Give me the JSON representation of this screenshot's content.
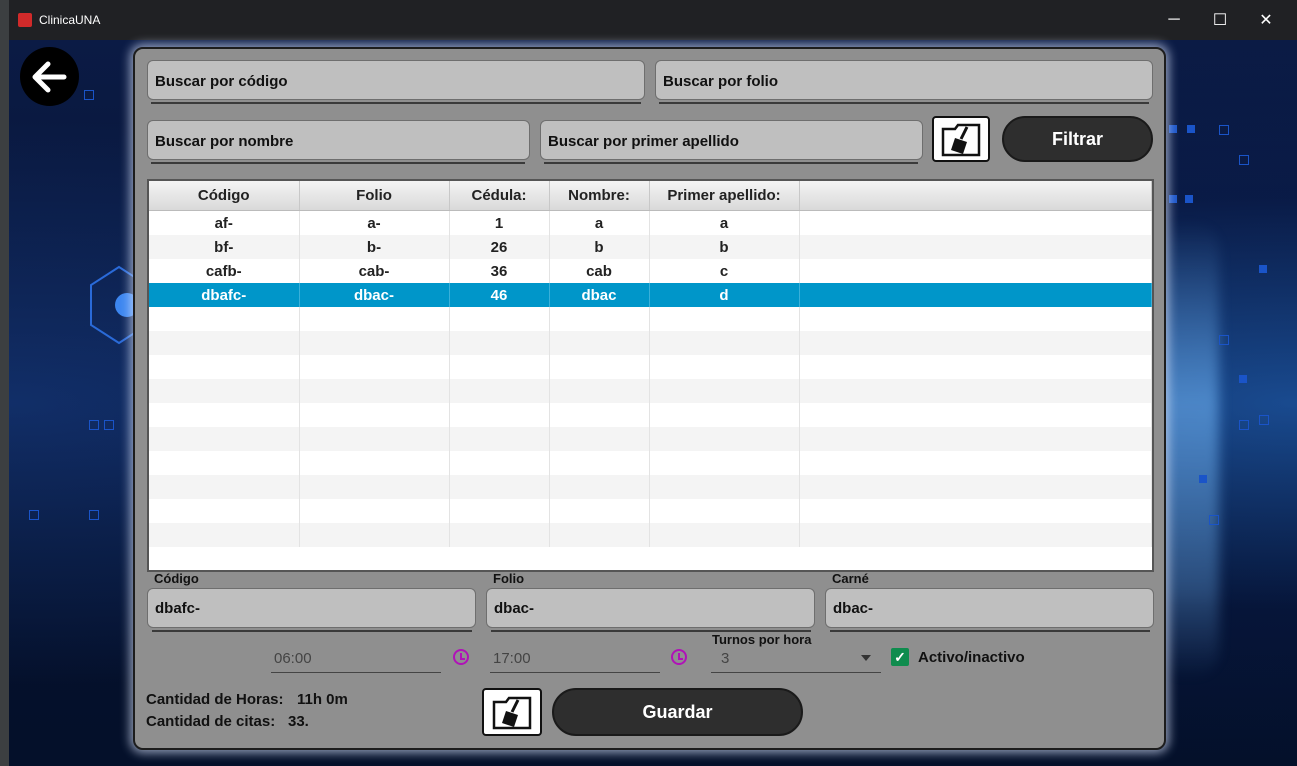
{
  "window": {
    "title": "ClinicaUNA",
    "minimize": "─",
    "maximize": "☐",
    "close": "✕"
  },
  "search": {
    "codigo_placeholder": "Buscar por código",
    "folio_placeholder": "Buscar por folio",
    "nombre_placeholder": "Buscar por nombre",
    "apellido_placeholder": "Buscar por primer apellido",
    "filter_label": "Filtrar"
  },
  "table": {
    "headers": [
      "Código",
      "Folio",
      "Cédula:",
      "Nombre:",
      "Primer apellido:"
    ],
    "rows": [
      [
        "af-",
        "a-",
        "1",
        "a",
        "a"
      ],
      [
        "bf-",
        "b-",
        "26",
        "b",
        "b"
      ],
      [
        "cafb-",
        "cab-",
        "36",
        "cab",
        "c"
      ],
      [
        "dbafc-",
        "dbac-",
        "46",
        "dbac",
        "d"
      ]
    ],
    "selected_row": 3
  },
  "form": {
    "codigo_label": "Código",
    "codigo_value": "dbafc-",
    "folio_label": "Folio",
    "folio_value": "dbac-",
    "carne_label": "Carné",
    "carne_value": "dbac-",
    "start_time": "06:00",
    "end_time": "17:00",
    "turnos_label": "Turnos por hora",
    "turnos_value": "3",
    "active_label": "Activo/inactivo",
    "active_checked": true,
    "horas_label": "Cantidad de Horas:",
    "horas_value": "11h 0m",
    "citas_label": "Cantidad de citas:",
    "citas_value": "33.",
    "save_label": "Guardar"
  },
  "colors": {
    "selected_row": "#0096c9",
    "clock_icon": "#b012b8",
    "checkbox": "#0f8c4e",
    "button": "#2e2e2e"
  },
  "icons": {
    "back": "arrow-left-icon",
    "clear": "broom-folder-icon",
    "clock": "clock-icon"
  }
}
